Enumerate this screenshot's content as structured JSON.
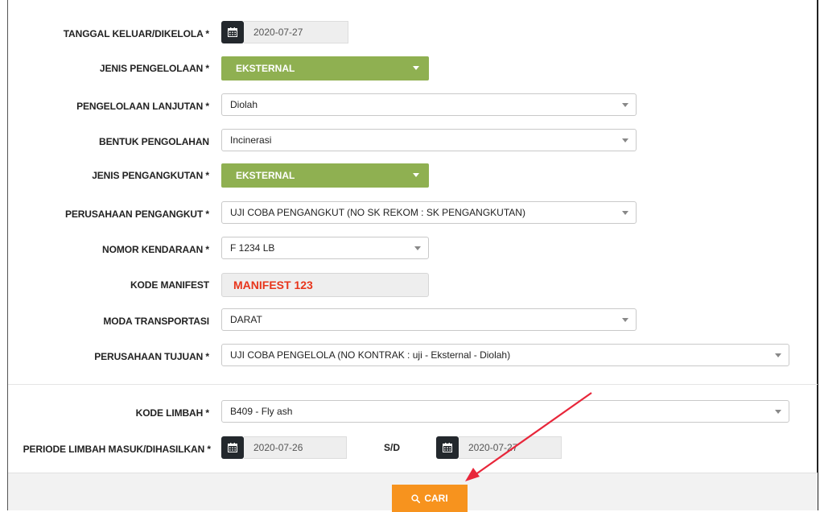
{
  "form": {
    "tanggal_keluar": {
      "label": "TANGGAL KELUAR/DIKELOLA *",
      "value": "2020-07-27"
    },
    "jenis_pengelolaan": {
      "label": "JENIS PENGELOLAAN *",
      "value": "EKSTERNAL"
    },
    "pengelolaan_lanjutan": {
      "label": "PENGELOLAAN LANJUTAN *",
      "value": "Diolah"
    },
    "bentuk_pengolahan": {
      "label": "BENTUK PENGOLAHAN",
      "value": "Incinerasi"
    },
    "jenis_pengangkutan": {
      "label": "JENIS PENGANGKUTAN *",
      "value": "EKSTERNAL"
    },
    "perusahaan_pengangkut": {
      "label": "PERUSAHAAN PENGANGKUT *",
      "value": "UJI COBA PENGANGKUT (NO SK REKOM : SK PENGANGKUTAN)"
    },
    "nomor_kendaraan": {
      "label": "NOMOR KENDARAAN *",
      "value": "F 1234 LB"
    },
    "kode_manifest": {
      "label": "KODE MANIFEST",
      "value": "MANIFEST 123"
    },
    "moda_transportasi": {
      "label": "MODA TRANSPORTASI",
      "value": "DARAT"
    },
    "perusahaan_tujuan": {
      "label": "PERUSAHAAN TUJUAN *",
      "value": "UJI COBA PENGELOLA (NO KONTRAK : uji - Eksternal - Diolah)"
    }
  },
  "search": {
    "kode_limbah": {
      "label": "KODE LIMBAH *",
      "value": "B409 - Fly ash"
    },
    "periode": {
      "label": "PERIODE LIMBAH MASUK/DIHASILKAN *",
      "from": "2020-07-26",
      "separator": "S/D",
      "to": "2020-07-27"
    }
  },
  "footer": {
    "cari_label": "CARI"
  },
  "colors": {
    "green": "#8fb051",
    "orange": "#f7931e",
    "manifest_red": "#e8351b",
    "arrow": "#e8263a"
  },
  "icons": {
    "calendar": "calendar-icon",
    "search": "search-icon",
    "caret": "chevron-down-icon"
  }
}
